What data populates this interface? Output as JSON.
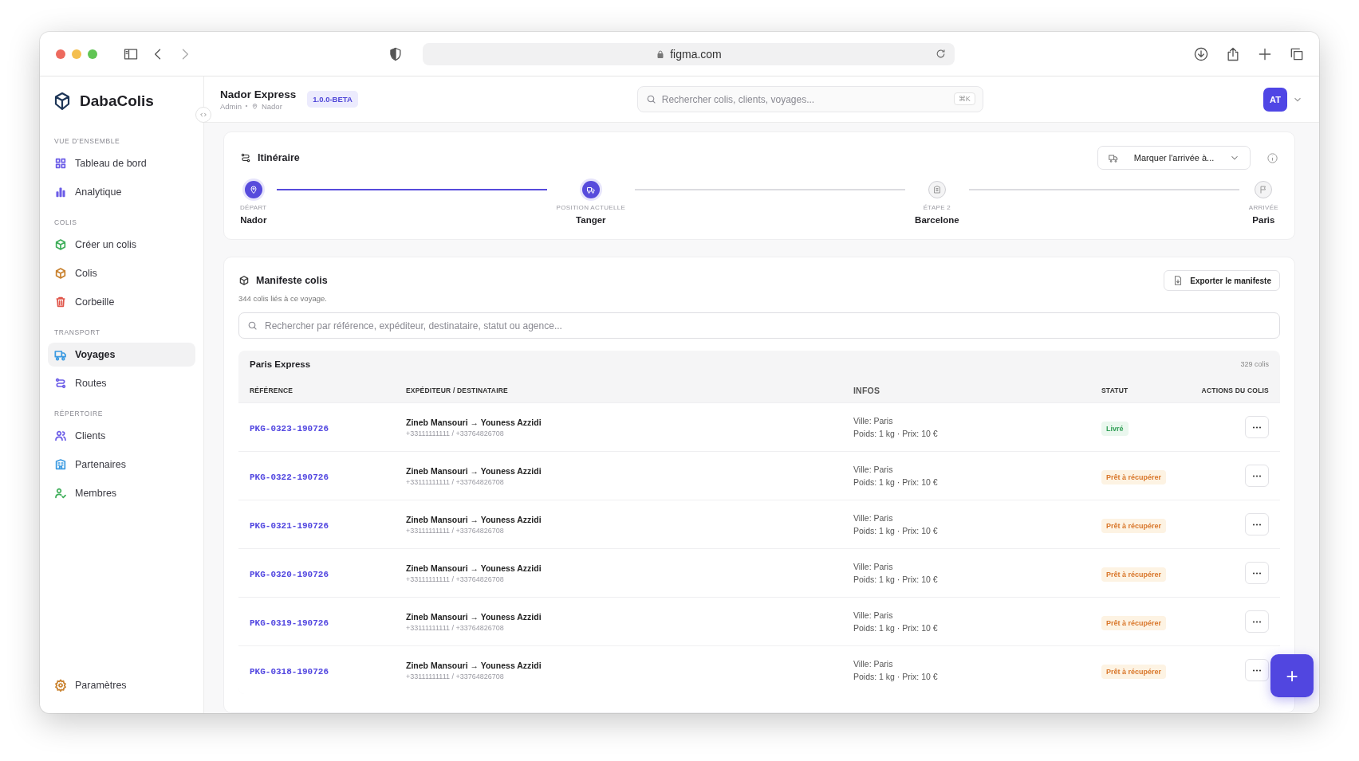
{
  "browser": {
    "url": "figma.com"
  },
  "sidebar": {
    "brand": "DabaColis",
    "sections": [
      {
        "label": "VUE D'ENSEMBLE",
        "items": [
          {
            "label": "Tableau de bord",
            "selected": false,
            "color": "#6b5ce7"
          },
          {
            "label": "Analytique",
            "selected": false,
            "color": "#6b5ce7"
          }
        ]
      },
      {
        "label": "COLIS",
        "items": [
          {
            "label": "Créer un colis",
            "selected": false,
            "color": "#3fae5a"
          },
          {
            "label": "Colis",
            "selected": false,
            "color": "#c9822f"
          },
          {
            "label": "Corbeille",
            "selected": false,
            "color": "#e0554a"
          }
        ]
      },
      {
        "label": "TRANSPORT",
        "items": [
          {
            "label": "Voyages",
            "selected": true,
            "color": "#3b9ae1"
          },
          {
            "label": "Routes",
            "selected": false,
            "color": "#6b5ce7"
          }
        ]
      },
      {
        "label": "RÉPERTOIRE",
        "items": [
          {
            "label": "Clients",
            "selected": false,
            "color": "#6b5ce7"
          },
          {
            "label": "Partenaires",
            "selected": false,
            "color": "#3b9ae1"
          },
          {
            "label": "Membres",
            "selected": false,
            "color": "#3fae5a"
          }
        ]
      }
    ],
    "footer_item": {
      "label": "Paramètres",
      "color": "#c9822f"
    }
  },
  "header": {
    "title": "Nador Express",
    "role": "Admin",
    "location": "Nador",
    "badge": "1.0.0-BETA",
    "search": {
      "placeholder": "Rechercher colis, clients, voyages...",
      "shortcut": "⌘K"
    },
    "avatar": "AT"
  },
  "itinerary": {
    "title": "Itinéraire",
    "action": "Marquer l'arrivée à...",
    "steps": [
      {
        "label": "DÉPART",
        "place": "Nador",
        "kind": "done"
      },
      {
        "label": "POSITION ACTUELLE",
        "place": "Tanger",
        "kind": "current"
      },
      {
        "label": "ÉTAPE 2",
        "place": "Barcelone",
        "kind": "pending"
      },
      {
        "label": "ARRIVÉE",
        "place": "Paris",
        "kind": "pending"
      }
    ]
  },
  "manifest": {
    "title": "Manifeste colis",
    "subtitle": "344 colis liés à ce voyage.",
    "export": "Exporter le manifeste",
    "search_placeholder": "Rechercher par référence, expéditeur, destinataire, statut ou agence...",
    "group": {
      "name": "Paris Express",
      "count": "329 colis"
    },
    "columns": [
      "RÉFÉRENCE",
      "EXPÉDITEUR / DESTINATAIRE",
      "INFOS",
      "STATUT",
      "ACTIONS DU COLIS"
    ],
    "rows": [
      {
        "reference": "PKG-0323-190726",
        "route": "Zineb Mansouri → Youness Azzidi",
        "phones": "+33111111111 / +33764826708",
        "city": "Ville: Paris",
        "details": "Poids: 1 kg · Prix: 10 €",
        "status": {
          "label": "Livré",
          "kind": "delivered"
        }
      },
      {
        "reference": "PKG-0322-190726",
        "route": "Zineb Mansouri → Youness Azzidi",
        "phones": "+33111111111 / +33764826708",
        "city": "Ville: Paris",
        "details": "Poids: 1 kg · Prix: 10 €",
        "status": {
          "label": "Prêt à récupérer",
          "kind": "ready"
        }
      },
      {
        "reference": "PKG-0321-190726",
        "route": "Zineb Mansouri → Youness Azzidi",
        "phones": "+33111111111 / +33764826708",
        "city": "Ville: Paris",
        "details": "Poids: 1 kg · Prix: 10 €",
        "status": {
          "label": "Prêt à récupérer",
          "kind": "ready"
        }
      },
      {
        "reference": "PKG-0320-190726",
        "route": "Zineb Mansouri → Youness Azzidi",
        "phones": "+33111111111 / +33764826708",
        "city": "Ville: Paris",
        "details": "Poids: 1 kg · Prix: 10 €",
        "status": {
          "label": "Prêt à récupérer",
          "kind": "ready"
        }
      },
      {
        "reference": "PKG-0319-190726",
        "route": "Zineb Mansouri → Youness Azzidi",
        "phones": "+33111111111 / +33764826708",
        "city": "Ville: Paris",
        "details": "Poids: 1 kg · Prix: 10 €",
        "status": {
          "label": "Prêt à récupérer",
          "kind": "ready"
        }
      },
      {
        "reference": "PKG-0318-190726",
        "route": "Zineb Mansouri → Youness Azzidi",
        "phones": "+33111111111 / +33764826708",
        "city": "Ville: Paris",
        "details": "Poids: 1 kg · Prix: 10 €",
        "status": {
          "label": "Prêt à récupérer",
          "kind": "ready"
        }
      }
    ]
  },
  "fab": "+"
}
